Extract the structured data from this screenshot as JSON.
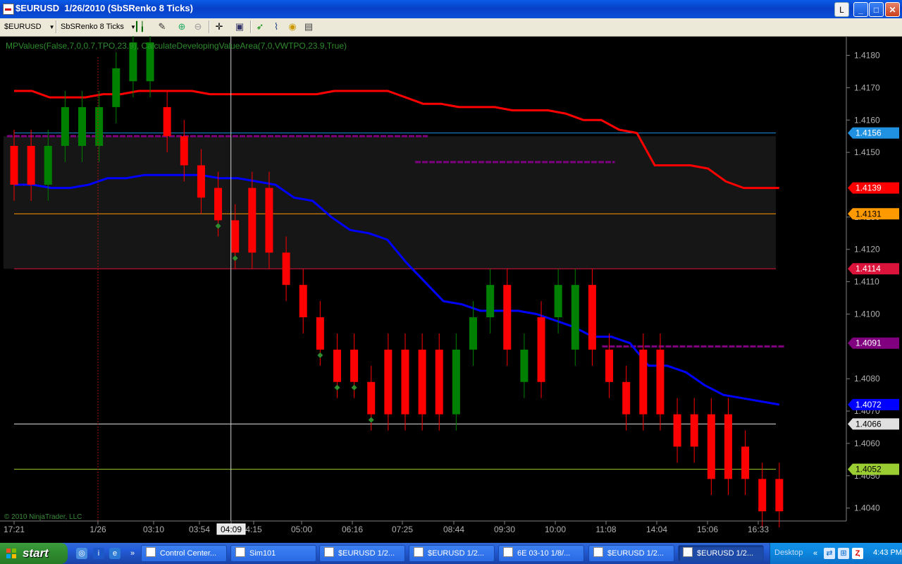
{
  "window": {
    "title": "$EURUSD  1/26/2010 (SbSRenko 8 Ticks)",
    "btn_l": "L",
    "btn_min": "_",
    "btn_max": "□",
    "btn_close": "✕"
  },
  "toolbar": {
    "instrument": "$EURUSD",
    "bar_type": "SbSRenko 8 Ticks"
  },
  "indicator_label": "MPValues(False,7,0,0.7,TPO,23.9), CalculateDevelopingValueArea(7,0,VWTPO,23.9,True)",
  "copyright": "© 2010 NinjaTrader, LLC",
  "colors": {
    "up": "#008000",
    "down": "#ff0000",
    "axis_text": "#b0b0b0",
    "grid": "#333333",
    "red_line": "#ff0000",
    "blue_line": "#0000ff",
    "purple": "#800080"
  },
  "price_axis": {
    "ticks": [
      "1.4180",
      "1.4170",
      "1.4160",
      "1.4150",
      "1.4130",
      "1.4120",
      "1.4110",
      "1.4100",
      "1.4080",
      "1.4070",
      "1.4060",
      "1.4050",
      "1.4040"
    ],
    "tick_values": [
      1.418,
      1.417,
      1.416,
      1.415,
      1.413,
      1.412,
      1.411,
      1.41,
      1.408,
      1.407,
      1.406,
      1.405,
      1.404
    ]
  },
  "time_axis": {
    "labels": [
      "17:21",
      "1/26",
      "03:10",
      "03:54",
      "04:09",
      "4:15",
      "05:00",
      "06:16",
      "07:25",
      "08:44",
      "09:30",
      "10:00",
      "11:08",
      "14:04",
      "15:06",
      "16:33"
    ],
    "cursor_label": "04:09"
  },
  "chart_data": {
    "type": "renko",
    "instrument": "$EURUSD",
    "y_range": [
      1.4036,
      1.4186
    ],
    "boxes": [
      {
        "open": 1.4152,
        "close": 1.414,
        "dir": "down"
      },
      {
        "open": 1.4152,
        "close": 1.414,
        "dir": "down"
      },
      {
        "open": 1.414,
        "close": 1.4152,
        "dir": "up"
      },
      {
        "open": 1.4152,
        "close": 1.4164,
        "dir": "up"
      },
      {
        "open": 1.4152,
        "close": 1.4164,
        "dir": "up"
      },
      {
        "open": 1.4152,
        "close": 1.4164,
        "dir": "up"
      },
      {
        "open": 1.4164,
        "close": 1.4176,
        "dir": "up"
      },
      {
        "open": 1.4172,
        "close": 1.4184,
        "dir": "up"
      },
      {
        "open": 1.4172,
        "close": 1.4184,
        "dir": "up"
      },
      {
        "open": 1.4164,
        "close": 1.4155,
        "dir": "down"
      },
      {
        "open": 1.4155,
        "close": 1.4146,
        "dir": "down"
      },
      {
        "open": 1.4146,
        "close": 1.4136,
        "dir": "down"
      },
      {
        "open": 1.4139,
        "close": 1.4129,
        "dir": "down"
      },
      {
        "open": 1.4129,
        "close": 1.4119,
        "dir": "down"
      },
      {
        "open": 1.4139,
        "close": 1.4119,
        "dir": "down"
      },
      {
        "open": 1.4139,
        "close": 1.4119,
        "dir": "down"
      },
      {
        "open": 1.4119,
        "close": 1.4109,
        "dir": "down"
      },
      {
        "open": 1.4109,
        "close": 1.4099,
        "dir": "down"
      },
      {
        "open": 1.4099,
        "close": 1.4089,
        "dir": "down"
      },
      {
        "open": 1.4089,
        "close": 1.4079,
        "dir": "down"
      },
      {
        "open": 1.4089,
        "close": 1.4079,
        "dir": "down"
      },
      {
        "open": 1.4079,
        "close": 1.4069,
        "dir": "down"
      },
      {
        "open": 1.4089,
        "close": 1.4069,
        "dir": "down"
      },
      {
        "open": 1.4089,
        "close": 1.4069,
        "dir": "down"
      },
      {
        "open": 1.4089,
        "close": 1.4069,
        "dir": "down"
      },
      {
        "open": 1.4089,
        "close": 1.4069,
        "dir": "down"
      },
      {
        "open": 1.4069,
        "close": 1.4089,
        "dir": "up"
      },
      {
        "open": 1.4089,
        "close": 1.4099,
        "dir": "up"
      },
      {
        "open": 1.4099,
        "close": 1.4109,
        "dir": "up"
      },
      {
        "open": 1.4109,
        "close": 1.4089,
        "dir": "down"
      },
      {
        "open": 1.4079,
        "close": 1.4089,
        "dir": "up"
      },
      {
        "open": 1.4099,
        "close": 1.4079,
        "dir": "down"
      },
      {
        "open": 1.4099,
        "close": 1.4109,
        "dir": "up"
      },
      {
        "open": 1.4089,
        "close": 1.4109,
        "dir": "up"
      },
      {
        "open": 1.4109,
        "close": 1.4089,
        "dir": "down"
      },
      {
        "open": 1.4089,
        "close": 1.4079,
        "dir": "down"
      },
      {
        "open": 1.4079,
        "close": 1.4069,
        "dir": "down"
      },
      {
        "open": 1.4089,
        "close": 1.4069,
        "dir": "down"
      },
      {
        "open": 1.4089,
        "close": 1.4069,
        "dir": "down"
      },
      {
        "open": 1.4069,
        "close": 1.4059,
        "dir": "down"
      },
      {
        "open": 1.4069,
        "close": 1.4059,
        "dir": "down"
      },
      {
        "open": 1.4069,
        "close": 1.4049,
        "dir": "down"
      },
      {
        "open": 1.4069,
        "close": 1.4049,
        "dir": "down"
      },
      {
        "open": 1.4059,
        "close": 1.4049,
        "dir": "down"
      },
      {
        "open": 1.4049,
        "close": 1.4039,
        "dir": "down"
      },
      {
        "open": 1.4049,
        "close": 1.4039,
        "dir": "down"
      }
    ],
    "red_line": [
      1.4169,
      1.4169,
      1.4167,
      1.4167,
      1.4167,
      1.4168,
      1.4168,
      1.4169,
      1.4169,
      1.4169,
      1.4169,
      1.4168,
      1.4168,
      1.4168,
      1.4168,
      1.4168,
      1.4168,
      1.4168,
      1.4169,
      1.4169,
      1.4169,
      1.4169,
      1.4167,
      1.4165,
      1.4165,
      1.4164,
      1.4164,
      1.4164,
      1.4163,
      1.4163,
      1.4163,
      1.4162,
      1.416,
      1.416,
      1.4157,
      1.4156,
      1.4146,
      1.4146,
      1.4146,
      1.4145,
      1.4141,
      1.4139,
      1.4139,
      1.4139
    ],
    "blue_line": [
      1.414,
      1.414,
      1.4139,
      1.4139,
      1.414,
      1.4142,
      1.4142,
      1.4143,
      1.4143,
      1.4143,
      1.4143,
      1.4142,
      1.4142,
      1.4141,
      1.414,
      1.4136,
      1.4135,
      1.413,
      1.4126,
      1.4125,
      1.4123,
      1.4116,
      1.411,
      1.4104,
      1.4103,
      1.4101,
      1.4101,
      1.4101,
      1.41,
      1.4098,
      1.4096,
      1.4093,
      1.4093,
      1.4091,
      1.4084,
      1.4084,
      1.4082,
      1.4078,
      1.4075,
      1.4074,
      1.4073,
      1.4072
    ],
    "levels": [
      {
        "label": "1.4156",
        "value": 1.4156,
        "color": "#2090e0"
      },
      {
        "label": "1.4139",
        "value": 1.4139,
        "color": "#ff0000"
      },
      {
        "label": "1.4131",
        "value": 1.4131,
        "color": "#ff9900"
      },
      {
        "label": "1.4114",
        "value": 1.4114,
        "color": "#dc143c"
      },
      {
        "label": "1.4091",
        "value": 1.4091,
        "color": "#800080"
      },
      {
        "label": "1.4072",
        "value": 1.4072,
        "color": "#0000ff"
      },
      {
        "label": "1.4066",
        "value": 1.4066,
        "color": "#e0e0e0"
      },
      {
        "label": "1.4052",
        "value": 1.4052,
        "color": "#9acd32"
      }
    ],
    "value_area": {
      "high": 1.4155,
      "low": 1.4114
    },
    "purple_segments": [
      {
        "value": 1.4155,
        "from_box": 0,
        "to_box": 24
      },
      {
        "value": 1.4147,
        "from_box": 24,
        "to_box": 35
      },
      {
        "value": 1.409,
        "from_box": 35,
        "to_box": 45
      }
    ],
    "markers": [
      12,
      13,
      18,
      19,
      20,
      21
    ],
    "cursor_box": 13
  },
  "taskbar": {
    "start": "start",
    "tasks": [
      "Control Center...",
      "Sim101",
      "$EURUSD  1/2...",
      "$EURUSD  1/2...",
      "6E 03-10  1/8/...",
      "$EURUSD  1/2...",
      "$EURUSD  1/2..."
    ],
    "desktop": "Desktop",
    "clock": "4:43 PM"
  }
}
